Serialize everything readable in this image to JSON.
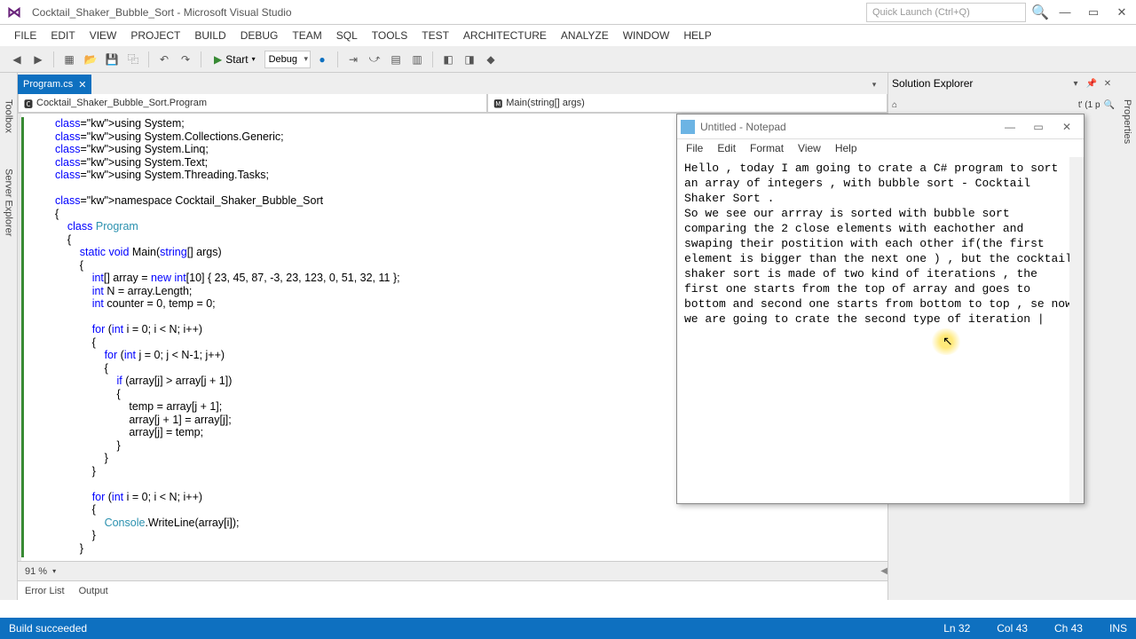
{
  "window": {
    "title": "Cocktail_Shaker_Bubble_Sort - Microsoft Visual Studio",
    "quicklaunch_placeholder": "Quick Launch (Ctrl+Q)"
  },
  "menu": [
    "FILE",
    "EDIT",
    "VIEW",
    "PROJECT",
    "BUILD",
    "DEBUG",
    "TEAM",
    "SQL",
    "TOOLS",
    "TEST",
    "ARCHITECTURE",
    "ANALYZE",
    "WINDOW",
    "HELP"
  ],
  "toolbar": {
    "start_label": "Start",
    "config": "Debug"
  },
  "left_tabs": [
    "Toolbox",
    "Server Explorer"
  ],
  "right_tabs": [
    "Properties"
  ],
  "file_tab": "Program.cs",
  "nav_left": "Cocktail_Shaker_Bubble_Sort.Program",
  "nav_right": "Main(string[] args)",
  "code_lines": [
    "using System;",
    "using System.Collections.Generic;",
    "using System.Linq;",
    "using System.Text;",
    "using System.Threading.Tasks;",
    "",
    "namespace Cocktail_Shaker_Bubble_Sort",
    "{",
    "    class Program",
    "    {",
    "        static void Main(string[] args)",
    "        {",
    "            int[] array = new int[10] { 23, 45, 87, -3, 23, 123, 0, 51, 32, 11 };",
    "            int N = array.Length;",
    "            int counter = 0, temp = 0;",
    "",
    "            for (int i = 0; i < N; i++)",
    "            {",
    "                for (int j = 0; j < N-1; j++)",
    "                {",
    "                    if (array[j] > array[j + 1])",
    "                    {",
    "                        temp = array[j + 1];",
    "                        array[j + 1] = array[j];",
    "                        array[j] = temp;",
    "                    }",
    "                }",
    "            }",
    "",
    "            for (int i = 0; i < N; i++)",
    "            {",
    "                Console.WriteLine(array[i]);",
    "            }",
    "        }"
  ],
  "zoom": "91 %",
  "bottom_panels": [
    "Error List",
    "Output"
  ],
  "sol_explorer": {
    "title": "Solution Explorer",
    "search_hint": "t' (1 p"
  },
  "status": {
    "message": "Build succeeded",
    "ln": "Ln 32",
    "col": "Col 43",
    "ch": "Ch 43",
    "ins": "INS"
  },
  "notepad": {
    "title": "Untitled - Notepad",
    "menu": [
      "File",
      "Edit",
      "Format",
      "View",
      "Help"
    ],
    "body": "Hello , today I am going to crate a C# program to sort an array of integers , with bubble sort - Cocktail Shaker Sort .\nSo we see our arrray is sorted with bubble sort comparing the 2 close elements with eachother and swaping their postition with each other if(the first element is bigger than the next one ) , but the cocktail shaker sort is made of two kind of iterations , the first one starts from the top of array and goes to bottom and second one starts from bottom to top , se now we are going to crate the second type of iteration |"
  }
}
